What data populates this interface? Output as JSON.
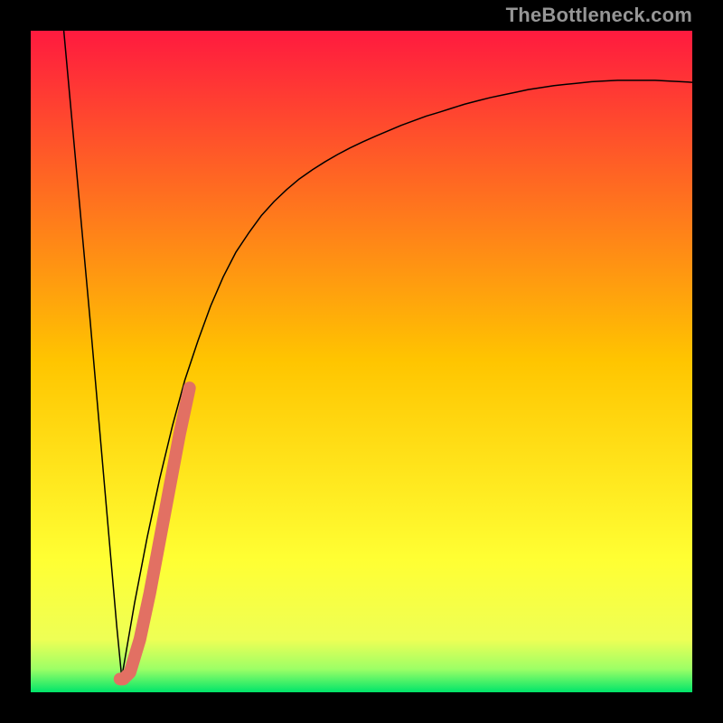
{
  "watermark": {
    "text": "TheBottleneck.com"
  },
  "chart_data": {
    "type": "line",
    "title": "",
    "xlabel": "",
    "ylabel": "",
    "xlim": [
      0,
      100
    ],
    "ylim": [
      0,
      100
    ],
    "gradient_stops": [
      {
        "offset": 0.0,
        "color": "#ff1a3f"
      },
      {
        "offset": 0.5,
        "color": "#ffc500"
      },
      {
        "offset": 0.8,
        "color": "#ffff33"
      },
      {
        "offset": 0.92,
        "color": "#eeff55"
      },
      {
        "offset": 0.965,
        "color": "#9cff66"
      },
      {
        "offset": 1.0,
        "color": "#00e56a"
      }
    ],
    "series": [
      {
        "name": "left-branch",
        "color": "#000000",
        "stroke_width": 1.5,
        "x": [
          5.0,
          6.0,
          7.0,
          8.0,
          9.0,
          10.0,
          11.0,
          12.0,
          13.0,
          13.8
        ],
        "y": [
          100,
          89,
          78,
          67,
          56,
          44.5,
          33.0,
          21.5,
          10.0,
          1.8
        ]
      },
      {
        "name": "right-branch",
        "color": "#000000",
        "stroke_width": 1.5,
        "x": [
          13.8,
          15.7,
          17.6,
          19.5,
          21.4,
          23.3,
          25.3,
          27.2,
          29.1,
          31.0,
          33.0,
          34.9,
          36.8,
          38.7,
          40.6,
          42.6,
          44.5,
          46.4,
          48.3,
          50.2,
          52.2,
          54.1,
          56.0,
          57.9,
          59.8,
          61.8,
          63.7,
          65.6,
          67.5,
          69.5,
          71.4,
          73.3,
          75.2,
          77.1,
          79.1,
          81.0,
          82.9,
          84.8,
          86.7,
          88.7,
          90.6,
          92.5,
          94.4,
          96.3,
          98.3,
          100.0
        ],
        "y": [
          2.5,
          13.5,
          23.4,
          32.3,
          40.2,
          47.2,
          53.2,
          58.4,
          62.8,
          66.5,
          69.5,
          72.1,
          74.2,
          76.0,
          77.6,
          79.0,
          80.2,
          81.3,
          82.3,
          83.2,
          84.1,
          84.9,
          85.7,
          86.4,
          87.1,
          87.7,
          88.3,
          88.9,
          89.4,
          89.9,
          90.3,
          90.7,
          91.1,
          91.4,
          91.7,
          91.9,
          92.1,
          92.3,
          92.4,
          92.5,
          92.5,
          92.5,
          92.5,
          92.4,
          92.3,
          92.2
        ]
      },
      {
        "name": "highlight-segment",
        "color": "#e27063",
        "stroke_width": 14,
        "x": [
          13.5,
          14.0,
          15.0,
          16.5,
          18.0,
          19.5,
          21.0,
          22.5,
          24.0
        ],
        "y": [
          2.0,
          2.0,
          3.0,
          8.0,
          15.0,
          23.0,
          31.0,
          39.0,
          46.0
        ]
      }
    ]
  }
}
